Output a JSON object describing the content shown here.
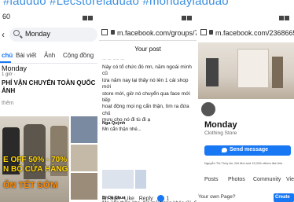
{
  "banner": {
    "hashtags": "#lauduo #Lecstoreladuao #mondayladuao"
  },
  "left": {
    "status_time": "60",
    "search_query": "Monday",
    "tabs": [
      "chủ",
      "Bài viết",
      "Ảnh",
      "Cộng đồng"
    ],
    "result_name": "Monday",
    "result_sub": "1 giờ · ",
    "result_title_1": "PHÍ VẬN CHUYỂN TOÀN QUỐC - GIẢ",
    "result_title_2": "ẢNH",
    "see_more": "thêm",
    "ad_line1": "E OFF 50% - 70%",
    "ad_line2": "N BỘ CỬA HÀNG",
    "ad_line3": "ỐN TẾT SỚM"
  },
  "mid": {
    "url": "m.facebook.com/groups/7",
    "post_title": "Your post",
    "cutoff_text": "... ... ..... ...",
    "post_body": "Này có tổ chức đó mn, năm ngoái mình cũ\nlừa năm nay lại thấy nó lên 1 cái shop mới\nstore mới, giờ nó chuyển qua face mới tiếp\nhoạt động mọi ng cẩn thận, tìm ra đứa chủ\nmưu cho nó đi tù đi ạ",
    "commenter": "Nga Quỳnh",
    "comment_text": "Mn cẩn thận nhé...",
    "meta_time": "on Sun",
    "meta_like": "Like",
    "meta_reply": "Reply",
    "like_count": "1",
    "comment2_name": "Bí Ca Chua",
    "comment2_text": "Mn cẩn thận nha. Nó mở trang khác rồi. Ca"
  },
  "right": {
    "url": "m.facebook.com/23686656C",
    "page_name": "Monday",
    "page_category": "Clothing Store",
    "send_message_label": "Send message",
    "likes_line": "Nguyễn Thị Thúy An, Mri Mol and 15,206 others like this",
    "tabs": [
      "Posts",
      "Photos",
      "Community",
      "Vie"
    ],
    "own_page_prompt": "Your own Page?",
    "create_label": "Create"
  },
  "colors": {
    "facebook_blue": "#1877f2",
    "hashtag_blue": "#3d8fe0"
  }
}
